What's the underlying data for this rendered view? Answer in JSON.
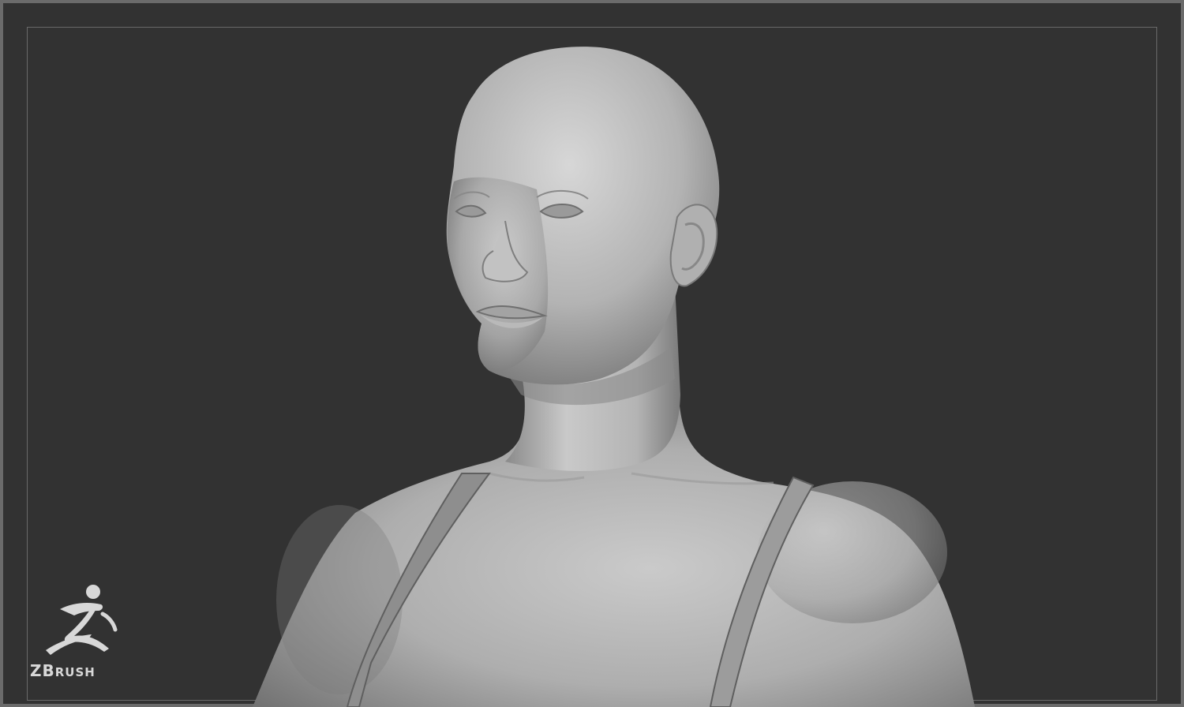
{
  "logo": {
    "icon": "zbrush-figure-icon",
    "text_big": "ZB",
    "text_small": "RUSH",
    "registered": "®"
  },
  "colors": {
    "background": "#323232",
    "frame": "#6b6b6b",
    "clay": "#bdbdbd"
  }
}
